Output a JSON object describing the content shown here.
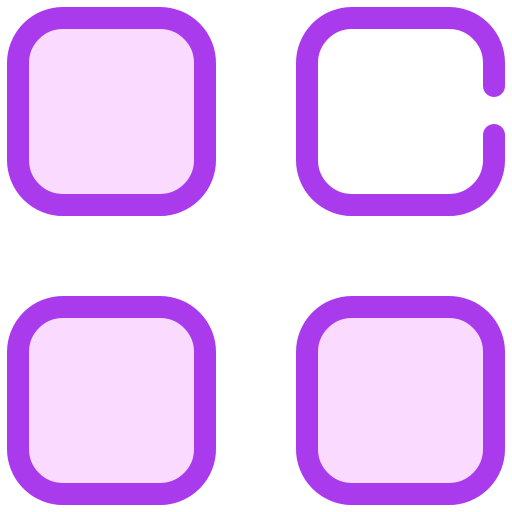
{
  "icon": {
    "name": "apps-grid-icon",
    "colors": {
      "stroke": "#A93BED",
      "fill": "#FADAFE",
      "background": "#FFFFFF"
    },
    "tiles": [
      {
        "name": "tile-top-left",
        "style": "filled"
      },
      {
        "name": "tile-top-right",
        "style": "open-outline"
      },
      {
        "name": "tile-bottom-left",
        "style": "filled"
      },
      {
        "name": "tile-bottom-right",
        "style": "filled"
      }
    ]
  }
}
